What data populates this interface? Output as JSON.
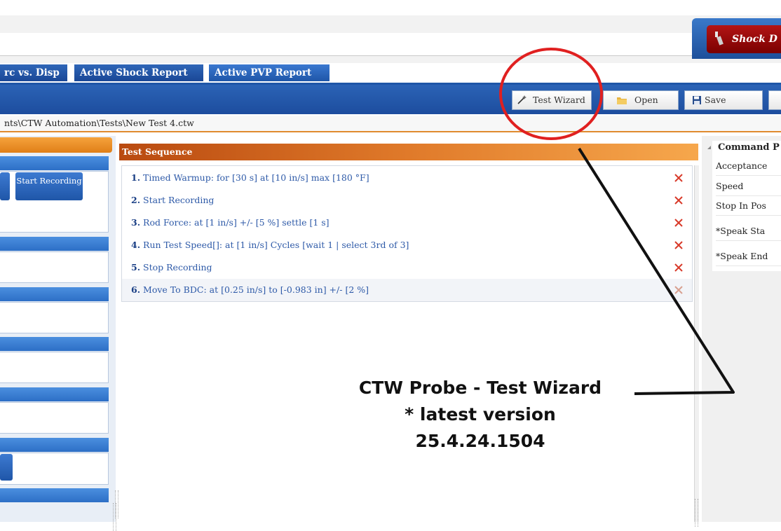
{
  "brand": {
    "label": "Shock D"
  },
  "tabs": [
    {
      "label": "rc vs. Disp"
    },
    {
      "label": "Active Shock Report"
    },
    {
      "label": "Active PVP Report"
    }
  ],
  "toolbar": {
    "test_wizard": "Test Wizard",
    "open": "Open",
    "save": "Save"
  },
  "path": "nts\\CTW Automation\\Tests\\New Test 4.ctw",
  "left_pane": {
    "start_recording": "Start Recording"
  },
  "test_sequence": {
    "title": "Test Sequence",
    "steps": [
      {
        "num": "1.",
        "text": "Timed Warmup: for [30 s] at [10 in/s] max [180 °F]"
      },
      {
        "num": "2.",
        "text": "Start Recording"
      },
      {
        "num": "3.",
        "text": "Rod Force: at [1 in/s] +/- [5 %] settle [1 s]"
      },
      {
        "num": "4.",
        "text": "Run Test Speed[]: at [1 in/s] Cycles [wait 1 | select 3rd of 3]"
      },
      {
        "num": "5.",
        "text": "Stop Recording"
      },
      {
        "num": "6.",
        "text": "Move To BDC: at [0.25 in/s] to [-0.983 in] +/- [2 %]"
      }
    ]
  },
  "command_panel": {
    "title": "Command P",
    "rows": [
      "Acceptance",
      "Speed",
      "Stop In Pos",
      "*Speak Sta",
      "*Speak End"
    ]
  },
  "annotation": {
    "line1": "CTW Probe - Test Wizard",
    "line2": "* latest version",
    "line3": "25.4.24.1504"
  },
  "colors": {
    "toolbar_blue": "#1f56a8",
    "header_orange": "#e07a2a",
    "brand_red": "#9a0b0b",
    "annotation_red": "#e02020",
    "delete_red": "#d83a2a"
  }
}
